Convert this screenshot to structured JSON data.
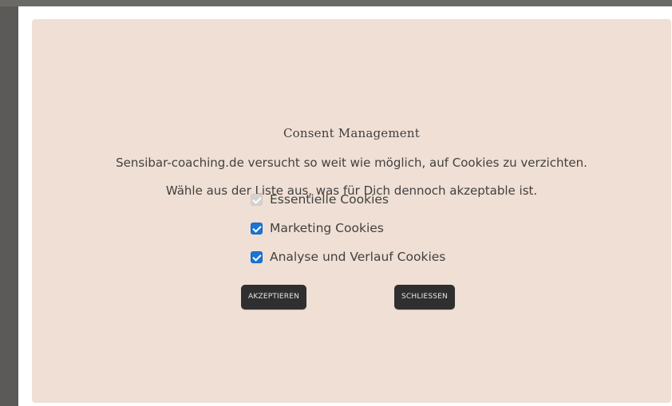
{
  "consent_modal": {
    "title": "Consent Management",
    "message_line1": "Sensibar-coaching.de versucht so weit wie möglich, auf Cookies zu verzichten.",
    "message_line2": "Wähle aus der Liste aus, was für Dich dennoch akzeptable ist.",
    "options": [
      {
        "label": "Essentielle Cookies",
        "checked": true,
        "disabled": true
      },
      {
        "label": "Marketing Cookies",
        "checked": true,
        "disabled": false
      },
      {
        "label": "Analyse und Verlauf Cookies",
        "checked": true,
        "disabled": false
      }
    ],
    "buttons": {
      "accept_label": "AKZEPTIEREN",
      "close_label": "SCHLIESSEN"
    }
  },
  "colors": {
    "backdrop": "#5b5a58",
    "modal_background": "#f0dfd4",
    "button_background": "#2f2f2f",
    "checkbox_checked": "#1976d2"
  },
  "icons": {
    "checkbox_checked": "checkmark-icon"
  }
}
